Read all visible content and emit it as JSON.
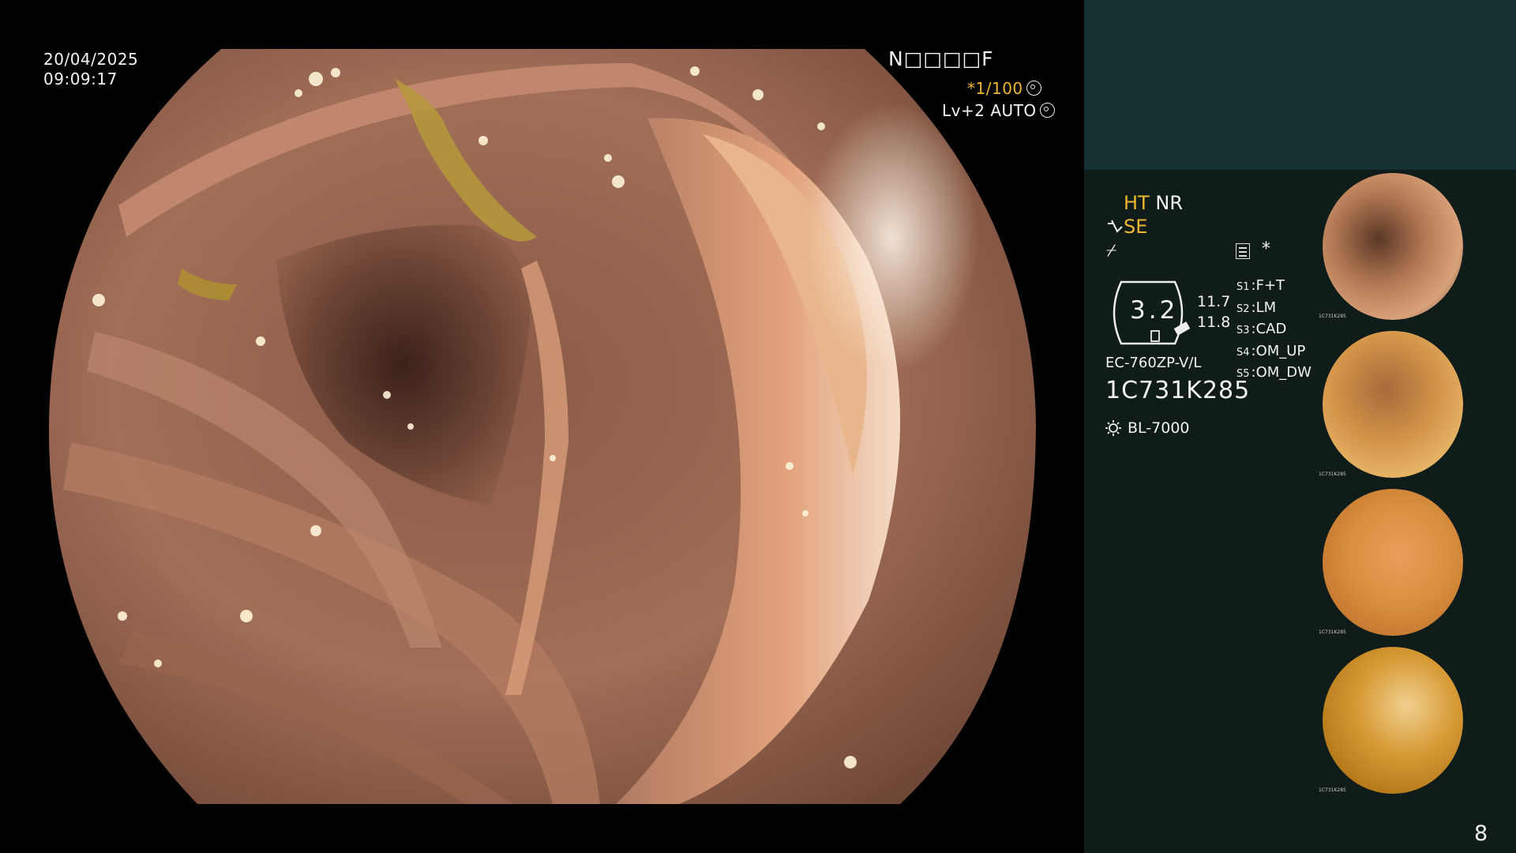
{
  "scope": {
    "date": "20/04/2025",
    "time": "09:09:17",
    "name_slot": "N□□□□F",
    "exposure": "*1/100",
    "level": "Lv+2 AUTO"
  },
  "panel": {
    "ht": "HT",
    "nr": "NR",
    "se": "SE",
    "flat_icon": "⌿",
    "star": "*",
    "zoom": "3.2",
    "zoom_side_1": "11.7",
    "zoom_side_2": "11.8",
    "slots": [
      {
        "key": "S1",
        "value": "F+T"
      },
      {
        "key": "S2",
        "value": "LM"
      },
      {
        "key": "S3",
        "value": "CAD"
      },
      {
        "key": "S4",
        "value": "OM_UP"
      },
      {
        "key": "S5",
        "value": "OM_DW"
      }
    ],
    "scope_model": "EC-760ZP-V/L",
    "serial": "1C731K285",
    "light_source": "BL-7000"
  },
  "thumbnails": [
    {
      "serial": "1C731K285",
      "tone": "#c98a5c"
    },
    {
      "serial": "1C731K285",
      "tone": "#d49448"
    },
    {
      "serial": "1C731K285",
      "tone": "#d98f40"
    },
    {
      "serial": "1C731K285",
      "tone": "#d79a35"
    }
  ],
  "page_number": "8",
  "colors": {
    "accent_orange": "#f0b830",
    "panel_top": "#163230",
    "panel_body": "#101c1a"
  }
}
